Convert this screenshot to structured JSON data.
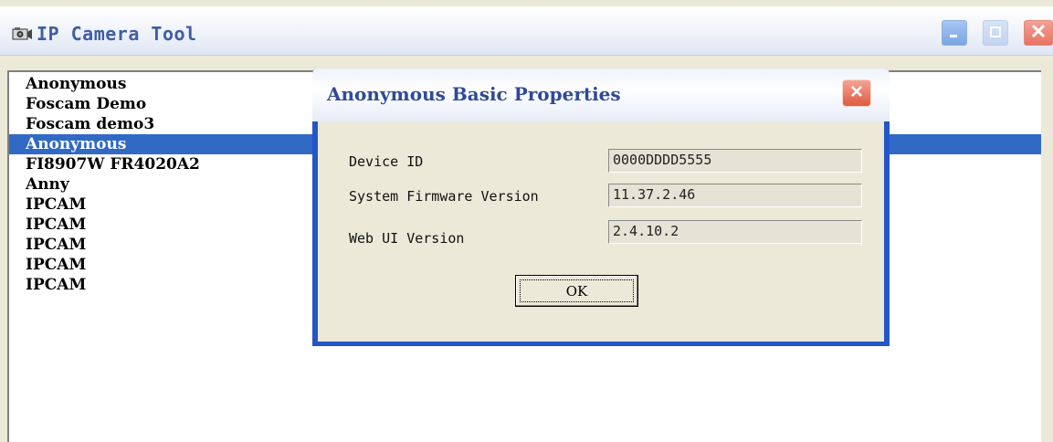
{
  "window": {
    "title": "IP Camera Tool",
    "icon": "app-camera-icon",
    "controls": [
      "minimize-icon",
      "maximize-icon",
      "close-icon"
    ]
  },
  "device_list": {
    "items": [
      {
        "label": "Anonymous",
        "selected": false
      },
      {
        "label": "Foscam Demo",
        "selected": false
      },
      {
        "label": "Foscam demo3",
        "selected": false
      },
      {
        "label": "Anonymous",
        "selected": true
      },
      {
        "label": "FI8907W FR4020A2",
        "selected": false
      },
      {
        "label": "Anny",
        "selected": false
      },
      {
        "label": "IPCAM",
        "selected": false
      },
      {
        "label": "IPCAM",
        "selected": false
      },
      {
        "label": "IPCAM",
        "selected": false
      },
      {
        "label": "IPCAM",
        "selected": false
      },
      {
        "label": "IPCAM",
        "selected": false
      }
    ]
  },
  "dialog": {
    "title": "Anonymous Basic Properties",
    "properties": [
      {
        "label": "Device ID",
        "value": "0000DDDD5555"
      },
      {
        "label": "System Firmware Version",
        "value": "11.37.2.46"
      },
      {
        "label": "Web UI Version",
        "value": "2.4.10.2"
      }
    ],
    "ok_label": "OK"
  },
  "colors": {
    "selection": "#316ac5",
    "dialog_frame": "#2456c8",
    "window_face": "#ece9d8",
    "title_text": "#3e5ea5",
    "close_button": "#e05b41"
  }
}
